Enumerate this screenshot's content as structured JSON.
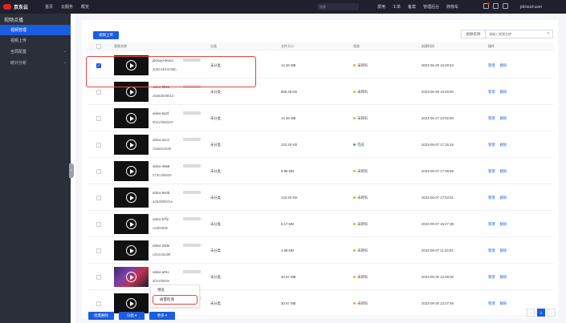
{
  "topbar": {
    "brand": "京东云",
    "nav": [
      "首页",
      "云服务",
      "概览"
    ],
    "search_placeholder": "搜索",
    "right_links": [
      "费用",
      "工单",
      "备案",
      "管理后台",
      "购物车"
    ],
    "user": "jdcloud-user"
  },
  "sidebar": {
    "title": "视频点播",
    "items": [
      {
        "label": "视频管理",
        "active": true
      },
      {
        "label": "视频上传",
        "active": false
      }
    ],
    "groups": [
      {
        "label": "全局配置"
      },
      {
        "label": "统计分析"
      }
    ]
  },
  "toolbar": {
    "upload_label": "视频上传",
    "search_type": "视频名称",
    "search_placeholder": "请输入视频名称"
  },
  "table": {
    "headers": {
      "name": "视频名称",
      "category": "分类",
      "size": "文件大小",
      "status": "状态",
      "created": "创建时间",
      "ops": "操作"
    },
    "rows": [
      {
        "name1": "jdcloud-demo",
        "name2": "268244fe3c96b",
        "category": "未分类",
        "size": "14.36 MB",
        "status": "未转码",
        "status_color": "#f5a623",
        "created": "2023-06-29 15:49:53",
        "checked": true,
        "thumb": "dark"
      },
      {
        "name1": "video-0b61",
        "name2": "a558d838b1d",
        "category": "未分类",
        "size": "885.29 KB",
        "status": "未转码",
        "status_color": "#f5a623",
        "created": "2023-06-29 15:48:50",
        "checked": false,
        "thumb": "dark"
      },
      {
        "name1": "video-6a2f",
        "name2": "9fecef58d497",
        "category": "未分类",
        "size": "14.36 MB",
        "status": "未转码",
        "status_color": "#f5a623",
        "created": "2023-06-27 10:02:50",
        "checked": false,
        "thumb": "dark"
      },
      {
        "name1": "video-11c3",
        "name2": "cbab8c464b",
        "category": "未分类",
        "size": "123.20 KB",
        "status": "完成",
        "status_color": "#2fb36a",
        "created": "2023-06-07 17:15:16",
        "checked": false,
        "thumb": "dark"
      },
      {
        "name1": "video-49a8",
        "name2": "073c2d9629",
        "category": "未分类",
        "size": "8.98 MB",
        "status": "未转码",
        "status_color": "#f5a623",
        "created": "2023-06-07 17:09:59",
        "checked": false,
        "thumb": "dark"
      },
      {
        "name1": "video-8e0d",
        "name2": "a2bd08f031e",
        "category": "未分类",
        "size": "123.20 KB",
        "status": "未转码",
        "status_color": "#f5a623",
        "created": "2023-06-07 17:04:51",
        "checked": false,
        "thumb": "dark"
      },
      {
        "name1": "video-b7f2",
        "name2": "ca3b99d6",
        "category": "未分类",
        "size": "6.17 MB",
        "status": "未转码",
        "status_color": "#f5a623",
        "created": "2023-06-07 16:47:38",
        "checked": false,
        "thumb": "dark"
      },
      {
        "name1": "video-33de",
        "name2": "c2b433ed9f",
        "category": "未分类",
        "size": "4.68 MB",
        "status": "未转码",
        "status_color": "#f5a623",
        "created": "2023-06-07 11:23:02",
        "checked": false,
        "thumb": "dark"
      },
      {
        "name1": "video-a01c",
        "name2": "af4c0f600e",
        "category": "未分类",
        "size": "30.67 MB",
        "status": "未转码",
        "status_color": "#f5a623",
        "created": "2023-05-30 12:29:00",
        "checked": false,
        "thumb": "color"
      },
      {
        "name1": "video-4920",
        "name2": "",
        "category": "未分类",
        "size": "30.67 MB",
        "status": "未转码",
        "status_color": "#f5a623",
        "created": "2023-05-30 12:27:49",
        "checked": false,
        "thumb": "dark"
      }
    ]
  },
  "row_ops": {
    "manage": "管理",
    "delete": "删除"
  },
  "popup": {
    "items": [
      "预览",
      "质量检测"
    ]
  },
  "footer": {
    "batch_delete": "批量删除",
    "category": "分类",
    "more": "更多",
    "page_prev": "‹",
    "page_current": "1",
    "page_next": "›"
  }
}
